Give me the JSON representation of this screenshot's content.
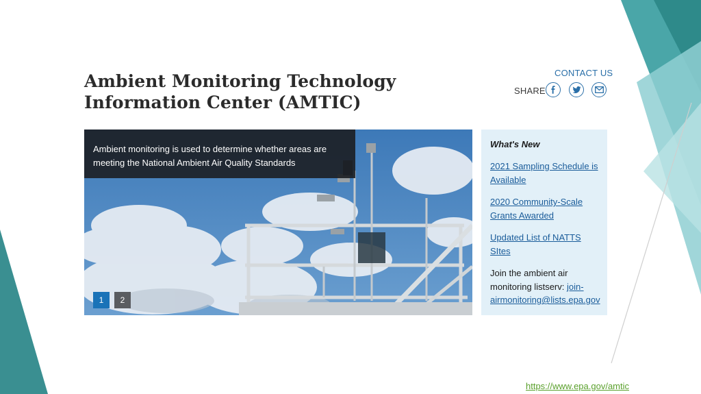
{
  "page": {
    "title": "Ambient Monitoring Technology Information Center (AMTIC)",
    "contact_label": "CONTACT US",
    "share_label": "SHARE"
  },
  "share": {
    "icons": [
      "facebook-icon",
      "twitter-icon",
      "email-icon"
    ]
  },
  "carousel": {
    "caption": "Ambient monitoring is used to determine whether areas are meeting the National Ambient Air Quality Standards",
    "slides": [
      "1",
      "2"
    ],
    "active_slide": "1"
  },
  "whats_new": {
    "heading": "What's New",
    "links": [
      "2021 Sampling Schedule is Available",
      "2020 Community-Scale Grants Awarded",
      "Updated List of NATTS SItes"
    ],
    "listserv_text": "Join the ambient air monitoring listserv:",
    "listserv_link": "join-airmonitoring@lists.epa.gov"
  },
  "footer": {
    "url": "https://www.epa.gov/amtic"
  },
  "colors": {
    "accent_blue": "#2a6fa8",
    "teal_dark": "#2e8b8b",
    "teal_light": "#9fd3d6",
    "news_bg": "#e2f0f8",
    "footer_link": "#5aa02c"
  }
}
